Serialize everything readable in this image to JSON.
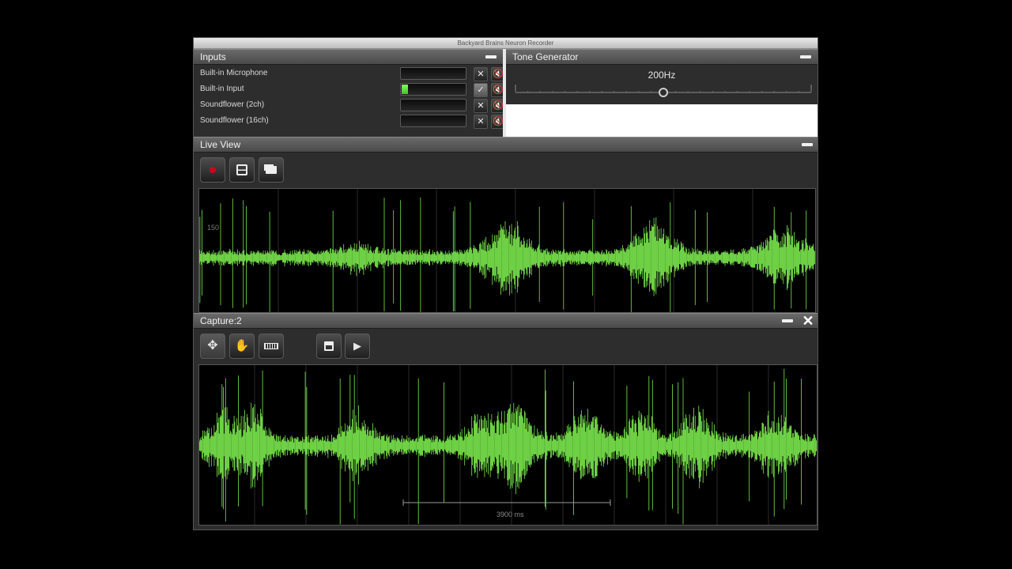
{
  "window": {
    "title": "Backyard Brains Neuron Recorder"
  },
  "inputs": {
    "title": "Inputs",
    "devices": [
      {
        "name": "Built-in Microphone",
        "level": 0.0,
        "enabled": false
      },
      {
        "name": "Built-in Input",
        "level": 0.1,
        "enabled": true
      },
      {
        "name": "Soundflower (2ch)",
        "level": 0.0,
        "enabled": false
      },
      {
        "name": "Soundflower (16ch)",
        "level": 0.0,
        "enabled": false
      }
    ]
  },
  "tone_generator": {
    "title": "Tone Generator",
    "frequency_label": "200Hz",
    "slider_value": 0.5
  },
  "live_view": {
    "title": "Live View",
    "buttons": [
      {
        "icon": "record-icon"
      },
      {
        "icon": "split-view-icon"
      },
      {
        "icon": "folder-icon"
      }
    ],
    "scale_label": "150",
    "trace_color": "#7be84d"
  },
  "capture": {
    "title": "Capture:2",
    "buttons": [
      {
        "icon": "move-icon"
      },
      {
        "icon": "hand-icon"
      },
      {
        "icon": "ruler-icon"
      },
      {
        "icon": "save-icon"
      },
      {
        "icon": "play-icon"
      }
    ],
    "scalebar_label": "3900 ms",
    "trace_color": "#7be84d"
  },
  "colors": {
    "trace": "#7be84d",
    "record": "#d0021b",
    "panel": "#2d2d2d"
  }
}
